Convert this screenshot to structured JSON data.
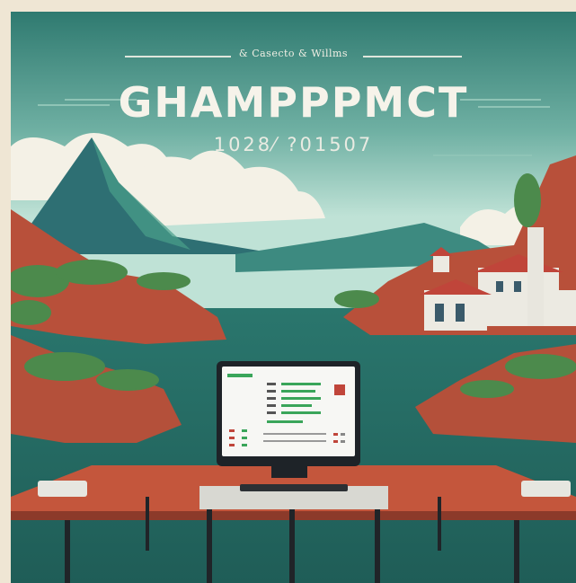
{
  "poster": {
    "subtitle": "& Casecto & Willms",
    "title": "GHAMPPPMCT",
    "numbers": "1028⁄ ?01507"
  },
  "colors": {
    "sky": "#b9ddd1",
    "water": "#2f7f74",
    "rock": "#c0573c",
    "desk": "#c4563c",
    "title": "#f6f3ea",
    "frame": "#efe6d4"
  }
}
